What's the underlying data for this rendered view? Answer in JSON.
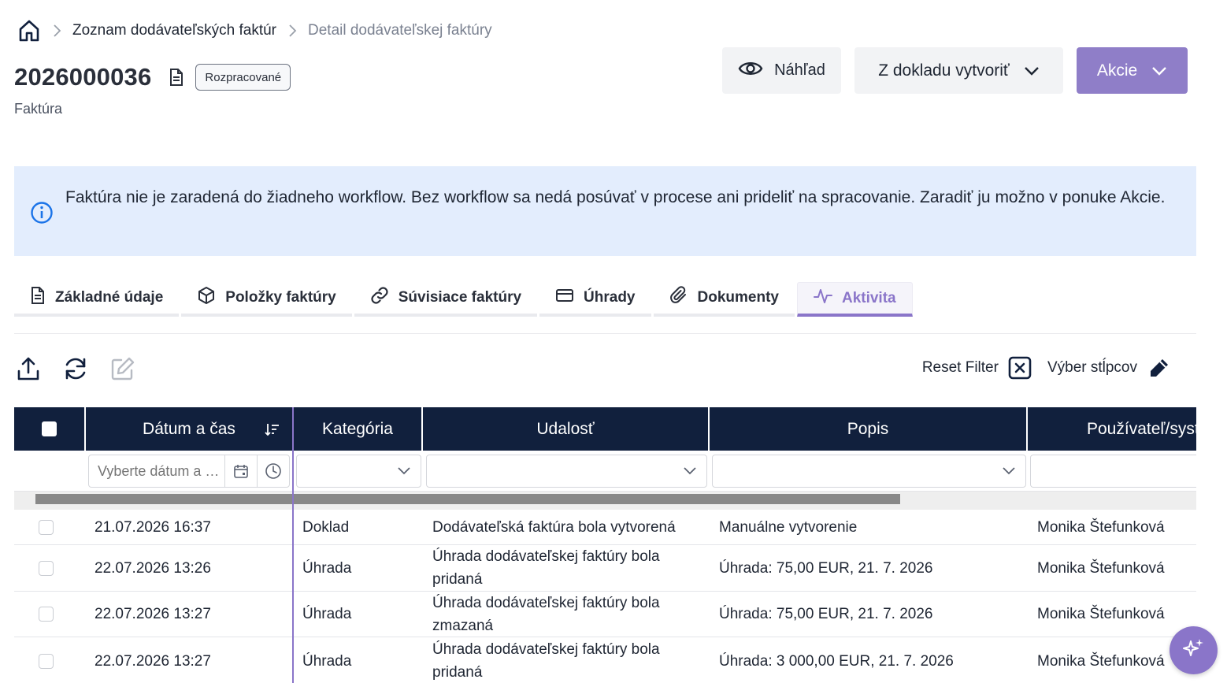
{
  "breadcrumb": {
    "items": [
      "Zoznam dodávateľských faktúr",
      "Detail dodávateľskej faktúry"
    ]
  },
  "document": {
    "number": "2026000036",
    "status": "Rozpracované",
    "type": "Faktúra"
  },
  "actions": {
    "preview": "Náhľad",
    "create_from": "Z dokladu vytvoriť",
    "actions": "Akcie"
  },
  "info": {
    "text": "Faktúra nie je zaradená do žiadneho workflow. Bez workflow sa nedá posúvať v procese ani prideliť na spracovanie. Zaradiť ju možno v ponuke Akcie."
  },
  "tabs": [
    {
      "label": "Základné údaje",
      "icon": "file-text-icon"
    },
    {
      "label": "Položky faktúry",
      "icon": "box-icon"
    },
    {
      "label": "Súvisiace faktúry",
      "icon": "link-icon"
    },
    {
      "label": "Úhrady",
      "icon": "credit-card-icon"
    },
    {
      "label": "Dokumenty",
      "icon": "paperclip-icon"
    },
    {
      "label": "Aktivita",
      "icon": "activity-icon"
    }
  ],
  "active_tab": "Aktivita",
  "toolbar": {
    "reset_filter": "Reset Filter",
    "column_select": "Výber stĺpcov"
  },
  "grid": {
    "columns": [
      "Dátum a čas",
      "Kategória",
      "Udalosť",
      "Popis",
      "Používateľ/systém"
    ],
    "date_filter_placeholder": "Vyberte dátum a čas",
    "rows": [
      {
        "datetime": "21.07.2026 16:37",
        "category": "Doklad",
        "event": "Dodávateľská faktúra bola vytvorená",
        "description": "Manuálne vytvorenie",
        "user": "Monika Štefunková"
      },
      {
        "datetime": "22.07.2026 13:26",
        "category": "Úhrada",
        "event": "Úhrada dodávateľskej faktúry bola pridaná",
        "description": "Úhrada: 75,00 EUR, 21. 7. 2026",
        "user": "Monika Štefunková"
      },
      {
        "datetime": "22.07.2026 13:27",
        "category": "Úhrada",
        "event": "Úhrada dodávateľskej faktúry bola zmazaná",
        "description": "Úhrada: 75,00 EUR, 21. 7. 2026",
        "user": "Monika Štefunková"
      },
      {
        "datetime": "22.07.2026 13:27",
        "category": "Úhrada",
        "event": "Úhrada dodávateľskej faktúry bola pridaná",
        "description": "Úhrada: 3 000,00 EUR, 21. 7. 2026",
        "user": "Monika Štefunková"
      }
    ]
  },
  "colors": {
    "accent": "#8a75c9",
    "header_bg": "#11203d",
    "info_bg": "#e3edfd",
    "info_icon": "#1a73e8"
  }
}
